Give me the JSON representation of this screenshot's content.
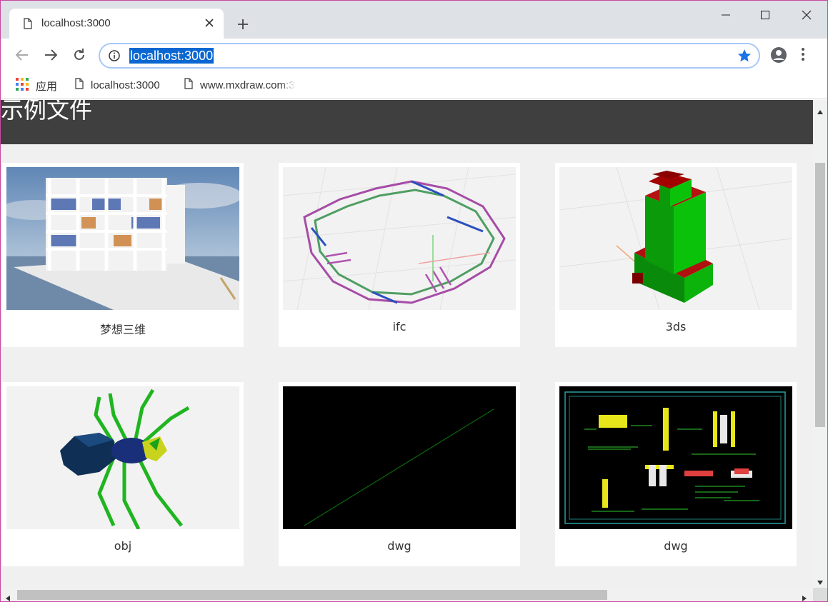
{
  "tab": {
    "title": "localhost:3000"
  },
  "omnibox": {
    "url": "localhost:3000"
  },
  "bookmarks": [
    {
      "label": "应用",
      "icon": "apps-grid-icon"
    },
    {
      "label": "localhost:3000",
      "icon": "page-icon"
    },
    {
      "label": "www.mxdraw.com:3",
      "icon": "page-icon"
    }
  ],
  "page": {
    "title": "示例文件"
  },
  "cards": [
    {
      "caption": "梦想三维"
    },
    {
      "caption": "ifc"
    },
    {
      "caption": "3ds"
    },
    {
      "caption": "obj"
    },
    {
      "caption": "dwg"
    },
    {
      "caption": "dwg"
    }
  ],
  "colors": {
    "accent": "#1a73e8",
    "header": "#3f3f3f",
    "selection": "#0a66d1"
  }
}
